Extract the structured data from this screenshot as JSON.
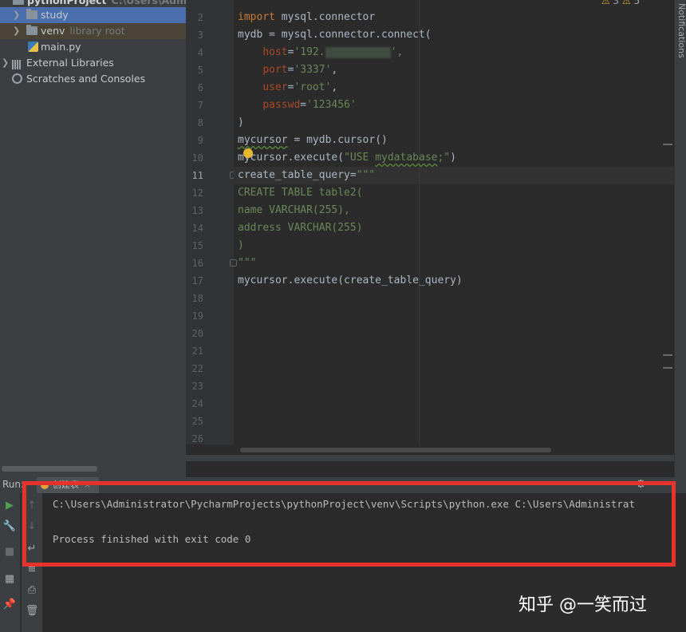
{
  "project": {
    "root_name": "pythonProject",
    "root_path": "C:\\Users\\Administrator",
    "items": [
      {
        "label": "study"
      },
      {
        "label": "venv",
        "hint": "library root"
      },
      {
        "label": "main.py"
      },
      {
        "label": "External Libraries"
      },
      {
        "label": "Scratches and Consoles"
      }
    ]
  },
  "editor": {
    "inspection": {
      "warnings": "3",
      "weak_warnings": "5"
    },
    "current_line": "11",
    "line_numbers": [
      "2",
      "3",
      "4",
      "5",
      "6",
      "7",
      "8",
      "9",
      "10",
      "11",
      "12",
      "13",
      "14",
      "15",
      "16",
      "17",
      "18",
      "19",
      "20",
      "21",
      "22",
      "23",
      "24",
      "25",
      "26"
    ],
    "code": {
      "l2_kw": "import",
      "l2_rest": " mysql.connector",
      "l3": "mydb = mysql.connector.connect(",
      "l4_param": "host",
      "l4_eq": "=",
      "l4_str": "'192.",
      "l4_str_end": "',",
      "l5_param": "port",
      "l5_eq": "=",
      "l5_str": "'3337'",
      "l5_comma": ",",
      "l6_param": "user",
      "l6_eq": "=",
      "l6_str": "'root'",
      "l6_comma": ",",
      "l7_param": "passwd",
      "l7_eq": "=",
      "l7_str": "'123456'",
      "l8": ")",
      "l9_var": "mycursor",
      "l9_rest": " = mydb.cursor()",
      "l10_a": "mycursor.execute(",
      "l10_str_a": "\"USE ",
      "l10_str_b": "mydatabase",
      "l10_str_c": ";\"",
      "l10_end": ")",
      "l11_var": "create_table_query",
      "l11_eq": "=",
      "l11_str": "\"\"\"",
      "l12": "CREATE TABLE table2(",
      "l13": "name VARCHAR(255),",
      "l14": "address VARCHAR(255)",
      "l15": ")",
      "l16": "\"\"\"",
      "l17": "mycursor.execute(create_table_query)"
    }
  },
  "notifications_label": "Notifications",
  "run": {
    "label": "Run:",
    "tab_title": "创建表",
    "tab_close": "×",
    "output": [
      "C:\\Users\\Administrator\\PycharmProjects\\pythonProject\\venv\\Scripts\\python.exe C:\\Users\\Administrat",
      "",
      "Process finished with exit code 0"
    ]
  },
  "watermark": "知乎 @一笑而过",
  "colors": {
    "highlight_box": "#e8322e",
    "selection": "#4b6eaf",
    "keyword": "#cc7832",
    "string": "#6a8759",
    "param": "#aa4926"
  },
  "icons": [
    "folder-icon",
    "python-file-icon",
    "library-icon",
    "scratch-icon",
    "warning-icon",
    "run-icon",
    "wrench-icon",
    "stop-icon",
    "gear-icon",
    "trash-icon",
    "pin-icon",
    "print-icon",
    "wrap-icon",
    "up-arrow-icon",
    "down-arrow-icon",
    "lightbulb-icon"
  ]
}
